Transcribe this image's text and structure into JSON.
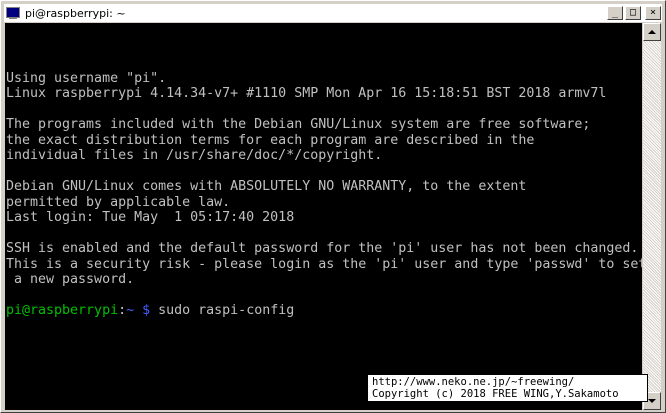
{
  "window": {
    "title": "pi@raspberrypi: ~",
    "controls": {
      "minimize": "_",
      "maximize": "□",
      "close": "×"
    }
  },
  "terminal": {
    "lines": [
      {
        "text": "Using username \"pi\"."
      },
      {
        "text": "Linux raspberrypi 4.14.34-v7+ #1110 SMP Mon Apr 16 15:18:51 BST 2018 armv7l"
      },
      {
        "text": ""
      },
      {
        "text": "The programs included with the Debian GNU/Linux system are free software;"
      },
      {
        "text": "the exact distribution terms for each program are described in the"
      },
      {
        "text": "individual files in /usr/share/doc/*/copyright."
      },
      {
        "text": ""
      },
      {
        "text": "Debian GNU/Linux comes with ABSOLUTELY NO WARRANTY, to the extent"
      },
      {
        "text": "permitted by applicable law."
      },
      {
        "text": "Last login: Tue May  1 05:17:40 2018"
      },
      {
        "text": ""
      },
      {
        "text": "SSH is enabled and the default password for the 'pi' user has not been changed."
      },
      {
        "text": "This is a security risk - please login as the 'pi' user and type 'passwd' to set"
      },
      {
        "text": " a new password."
      },
      {
        "text": ""
      }
    ],
    "prompt": {
      "user_host": "pi@raspberrypi",
      "separator": ":",
      "path": "~ $",
      "command": " sudo raspi-config"
    }
  },
  "watermark": {
    "line1": "http://www.neko.ne.jp/~freewing/",
    "line2": "Copyright (c) 2018 FREE WING,Y.Sakamoto"
  }
}
